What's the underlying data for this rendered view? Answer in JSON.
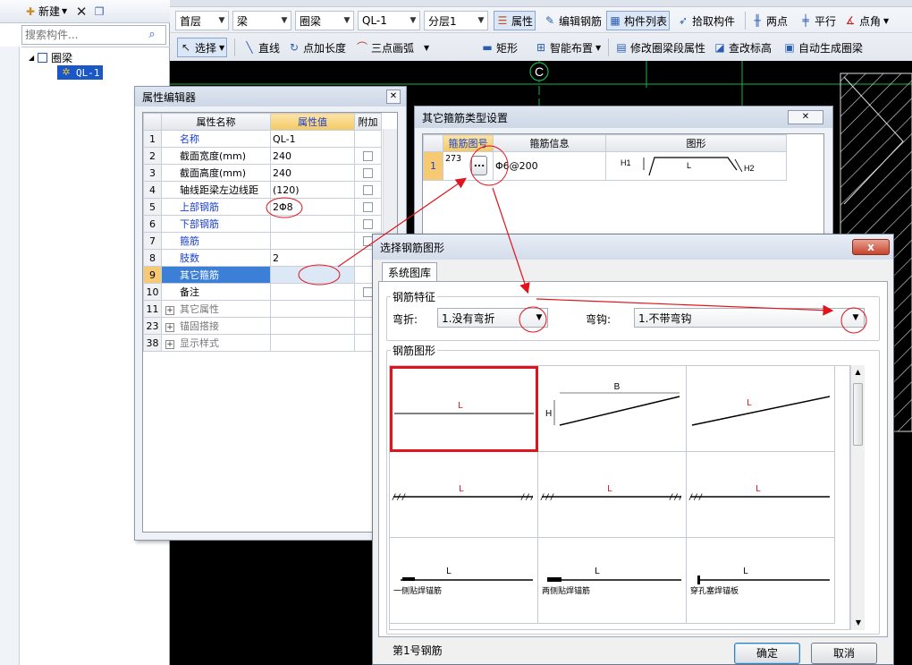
{
  "left_panel": {
    "new_label": "新建",
    "search_placeholder": "搜索构件...",
    "tree_root": "圈梁",
    "tree_child": "QL-1"
  },
  "toolbar1": {
    "floor": "首层",
    "category": "梁",
    "type": "圈梁",
    "component": "QL-1",
    "layer": "分层1",
    "btn_property": "属性",
    "btn_edit_rebar": "编辑钢筋",
    "btn_component_list": "构件列表",
    "btn_pick_component": "拾取构件",
    "btn_two_points": "两点",
    "btn_parallel": "平行",
    "btn_angle": "点角"
  },
  "toolbar2": {
    "btn_select": "选择",
    "btn_line": "直线",
    "btn_point_length": "点加长度",
    "btn_three_point_arc": "三点画弧",
    "btn_rectangle": "矩形",
    "btn_smart_layout": "智能布置",
    "btn_modify_segment": "修改圈梁段属性",
    "btn_modify_elevation": "查改标高",
    "btn_auto_generate": "自动生成圈梁"
  },
  "canvas": {
    "axis_label": "C"
  },
  "prop_editor": {
    "title": "属性编辑器",
    "col_name": "属性名称",
    "col_value": "属性值",
    "col_extra": "附加",
    "rows": [
      {
        "num": "1",
        "name": "名称",
        "value": "QL-1",
        "style": "blue",
        "check": false
      },
      {
        "num": "2",
        "name": "截面宽度(mm)",
        "value": "240",
        "style": "normal",
        "check": true
      },
      {
        "num": "3",
        "name": "截面高度(mm)",
        "value": "240",
        "style": "normal",
        "check": true
      },
      {
        "num": "4",
        "name": "轴线距梁左边线距",
        "value": "(120)",
        "style": "normal",
        "check": true
      },
      {
        "num": "5",
        "name": "上部钢筋",
        "value": "2Φ8",
        "style": "blue",
        "check": true
      },
      {
        "num": "6",
        "name": "下部钢筋",
        "value": "",
        "style": "blue",
        "check": true
      },
      {
        "num": "7",
        "name": "箍筋",
        "value": "",
        "style": "blue",
        "check": true
      },
      {
        "num": "8",
        "name": "肢数",
        "value": "2",
        "style": "blue",
        "check": false
      },
      {
        "num": "9",
        "name": "其它箍筋",
        "value": "",
        "style": "selected",
        "check": false
      },
      {
        "num": "10",
        "name": "备注",
        "value": "",
        "style": "normal",
        "check": true
      },
      {
        "num": "11",
        "name": "其它属性",
        "value": "",
        "style": "grey",
        "check": false
      },
      {
        "num": "23",
        "name": "锚固搭接",
        "value": "",
        "style": "grey",
        "check": false
      },
      {
        "num": "38",
        "name": "显示样式",
        "value": "",
        "style": "grey",
        "check": false
      }
    ]
  },
  "stirrup_window": {
    "title": "其它箍筋类型设置",
    "col_shape_no": "箍筋图号",
    "col_info": "箍筋信息",
    "col_figure": "图形",
    "row_num": "1",
    "shape_no": "273",
    "ellipsis": "...",
    "info": "Φ6@200",
    "fig_h1": "H1",
    "fig_l": "L",
    "fig_h2": "H2"
  },
  "shape_window": {
    "title": "选择钢筋图形",
    "close_label": "x",
    "tab": "系统图库",
    "feature_group": "钢筋特征",
    "bend_label": "弯折:",
    "bend_value": "1.没有弯折",
    "hook_label": "弯钩:",
    "hook_value": "1.不带弯钩",
    "shape_group": "钢筋图形",
    "cells": [
      {
        "label": "L",
        "caption": ""
      },
      {
        "label": "B",
        "caption": "",
        "h": "H"
      },
      {
        "label": "L",
        "caption": ""
      },
      {
        "label": "L",
        "caption": ""
      },
      {
        "label": "L",
        "caption": ""
      },
      {
        "label": "L",
        "caption": ""
      },
      {
        "label": "L",
        "caption": "一侧贴焊锚筋"
      },
      {
        "label": "L",
        "caption": "两侧贴焊锚筋"
      },
      {
        "label": "L",
        "caption": "穿孔塞焊锚板"
      }
    ],
    "status": "第1号钢筋",
    "ok": "确定",
    "cancel": "取消"
  }
}
